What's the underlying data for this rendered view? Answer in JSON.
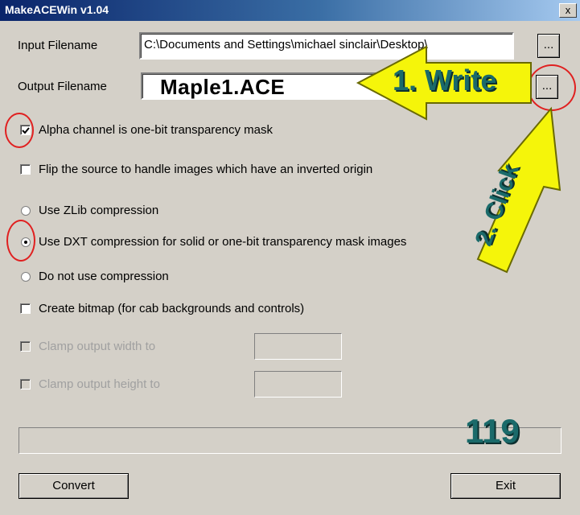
{
  "window": {
    "title": "MakeACEWin v1.04",
    "close_label": "x"
  },
  "input": {
    "label": "Input Filename",
    "value": "C:\\Documents and Settings\\michael sinclair\\Desktop\\",
    "browse_label": "..."
  },
  "output": {
    "label": "Output Filename",
    "value": "Maple1.ACE",
    "browse_label": "..."
  },
  "options": {
    "alpha": {
      "label": "Alpha channel is one-bit transparency mask",
      "checked": true
    },
    "flip": {
      "label": "Flip the source to handle images which have an inverted origin",
      "checked": false
    },
    "zlib": {
      "label": "Use ZLib compression",
      "selected": false
    },
    "dxt": {
      "label": "Use DXT compression for solid or one-bit transparency mask images",
      "selected": true
    },
    "none": {
      "label": "Do not use compression",
      "selected": false
    },
    "bitmap": {
      "label": "Create bitmap (for cab backgrounds and controls)",
      "checked": false
    },
    "clamp_width": {
      "label": "Clamp output width to",
      "value": "",
      "enabled": false
    },
    "clamp_height": {
      "label": "Clamp output height to",
      "value": "",
      "enabled": false
    }
  },
  "progress": {
    "value": 0
  },
  "buttons": {
    "convert": "Convert",
    "exit": "Exit"
  },
  "annotations": {
    "write": "1. Write",
    "click": "2. Click",
    "number": "119"
  },
  "colors": {
    "arrow": "#f5f50a",
    "annotation_text": "#1a6a6a",
    "highlight_circle": "#e02020"
  }
}
